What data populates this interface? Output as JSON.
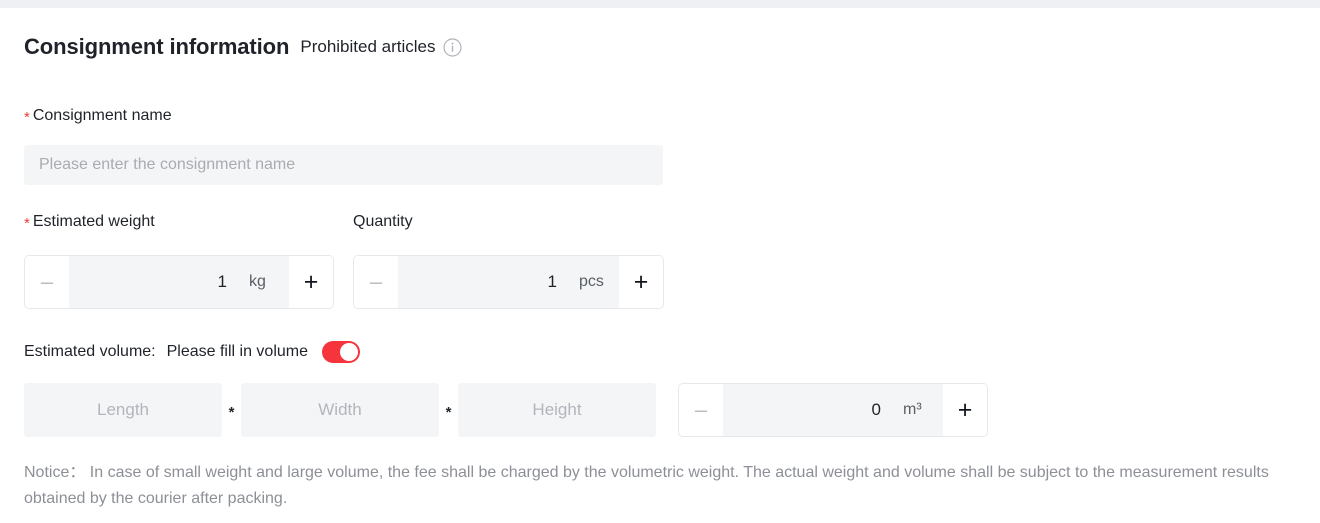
{
  "header": {
    "title": "Consignment information",
    "subtitle": "Prohibited articles",
    "info_icon": "info-circle-icon"
  },
  "consignment_name": {
    "required_marker": "*",
    "label": "Consignment name",
    "placeholder": "Please enter the consignment name",
    "value": ""
  },
  "estimated_weight": {
    "required_marker": "*",
    "label": "Estimated weight",
    "minus_label": "–",
    "value": "1",
    "unit": "kg",
    "plus_label": "+"
  },
  "quantity": {
    "label": "Quantity",
    "minus_label": "–",
    "value": "1",
    "unit": "pcs",
    "plus_label": "+"
  },
  "estimated_volume": {
    "label": "Estimated volume:",
    "hint": "Please fill in volume",
    "toggle_state": "on",
    "toggle_color": "#f5353b",
    "minus_label": "–",
    "value": "0",
    "unit": "m³",
    "plus_label": "+"
  },
  "dimensions": {
    "length_placeholder": "Length",
    "length_value": "",
    "width_placeholder": "Width",
    "width_value": "",
    "height_placeholder": "Height",
    "height_value": "",
    "separator": "*"
  },
  "notice": {
    "text": "Notice： In case of small weight and large volume, the fee shall be charged by the volumetric weight. The actual weight and volume shall be subject to the measurement results obtained by the courier after packing."
  },
  "colors": {
    "required_red": "#e8403a",
    "toggle_red": "#f5353b",
    "input_bg": "#f4f5f7",
    "text_primary": "#1f2329",
    "text_muted": "#8c9096"
  }
}
